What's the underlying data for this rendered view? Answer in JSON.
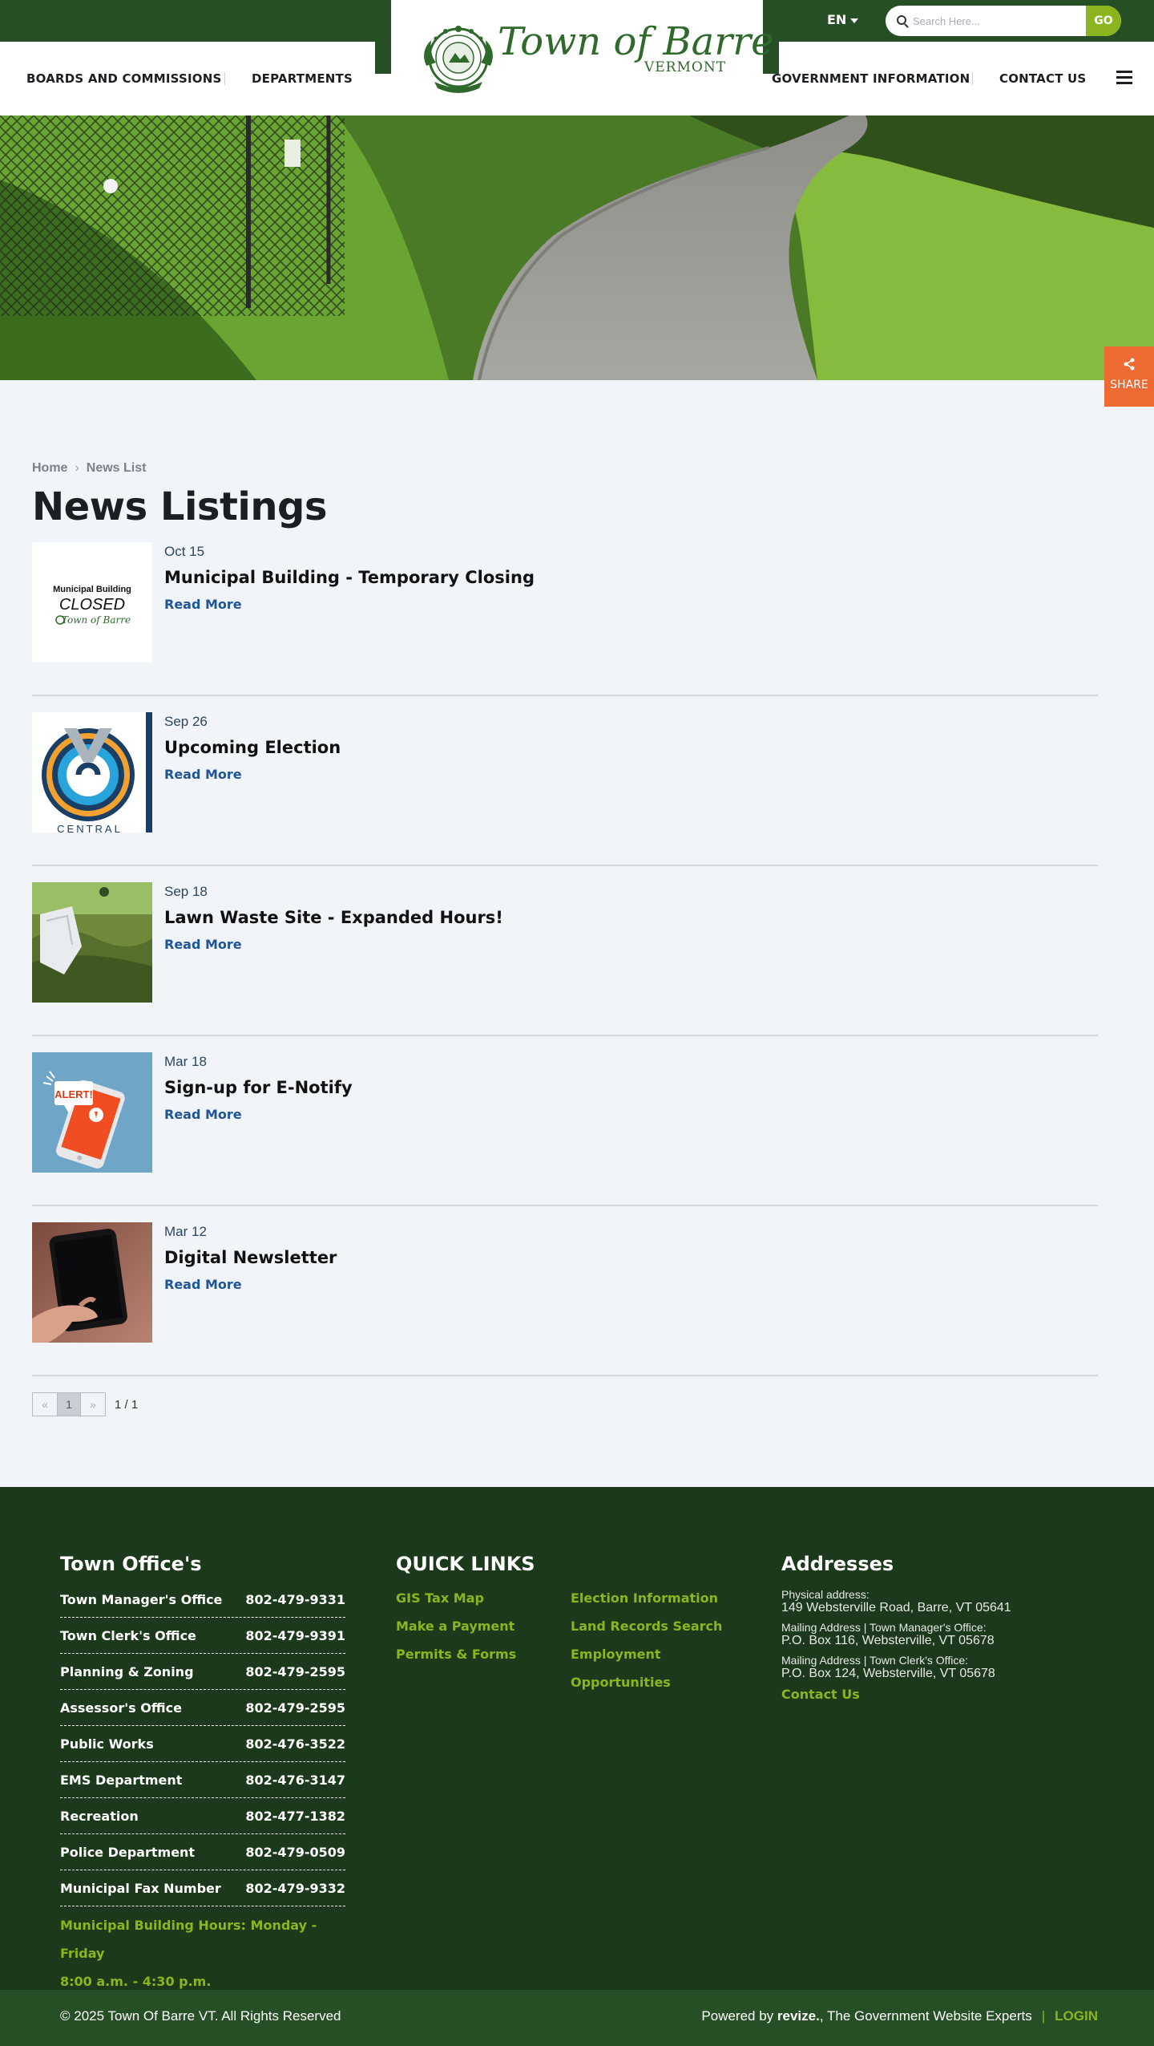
{
  "topbar": {
    "lang": "EN",
    "search_placeholder": "Search Here...",
    "go_label": "GO"
  },
  "nav": {
    "left": [
      "BOARDS AND COMMISSIONS",
      "DEPARTMENTS"
    ],
    "right": [
      "GOVERNMENT INFORMATION",
      "CONTACT US"
    ],
    "logo_main": "Town of Barre",
    "logo_sub": "VERMONT"
  },
  "share_label": "SHARE",
  "breadcrumb": {
    "home": "Home",
    "current": "News List"
  },
  "page_title": "News Listings",
  "read_more": "Read More",
  "news": [
    {
      "date": "Oct 15",
      "title": "Municipal Building - Temporary Closing"
    },
    {
      "date": "Sep 26",
      "title": "Upcoming Election"
    },
    {
      "date": "Sep 18",
      "title": "Lawn Waste Site - Expanded Hours!"
    },
    {
      "date": "Mar 18",
      "title": "Sign-up for E-Notify"
    },
    {
      "date": "Mar 12",
      "title": "Digital Newsletter"
    }
  ],
  "thumbs": {
    "closed_line1": "Municipal Building",
    "closed_line2": "CLOSED",
    "closed_line3": "Town of Barre",
    "central_label": "CENTRAL",
    "alert_label": "ALERT!"
  },
  "pager": {
    "prev": "«",
    "current": "1",
    "next": "»",
    "count": "1 / 1"
  },
  "footer": {
    "offices_title": "Town Office's",
    "offices": [
      {
        "name": "Town Manager's Office",
        "phone": "802-479-9331"
      },
      {
        "name": "Town Clerk's Office",
        "phone": "802-479-9391"
      },
      {
        "name": "Planning & Zoning",
        "phone": "802-479-2595"
      },
      {
        "name": "Assessor's Office",
        "phone": "802-479-2595"
      },
      {
        "name": "Public Works",
        "phone": "802-476-3522"
      },
      {
        "name": "EMS Department",
        "phone": "802-476-3147"
      },
      {
        "name": "Recreation",
        "phone": "802-477-1382"
      },
      {
        "name": "Police Department",
        "phone": "802-479-0509"
      },
      {
        "name": "Municipal Fax Number",
        "phone": "802-479-9332"
      }
    ],
    "hours_line1": "Municipal Building Hours:  Monday - Friday",
    "hours_line2": "8:00 a.m. - 4:30 p.m.",
    "quick_title": "QUICK LINKS",
    "quick_col1": [
      "GIS Tax Map",
      "Make a Payment",
      "Permits & Forms"
    ],
    "quick_col2": [
      "Election Information",
      "Land Records Search",
      "Employment",
      "Opportunities"
    ],
    "addr_title": "Addresses",
    "addresses": [
      {
        "label": "Physical address:",
        "value": "149 Websterville Road, Barre, VT 05641"
      },
      {
        "label": "Mailing Address | Town Manager's Office:",
        "value": "P.O. Box 116, Websterville, VT 05678"
      },
      {
        "label": "Mailing Address | Town Clerk's Office:",
        "value": "P.O. Box 124, Websterville, VT 05678"
      }
    ],
    "contact_link": "Contact Us",
    "copyright": "© 2025 Town Of Barre VT. All Rights Reserved",
    "powered_pre": "Powered by ",
    "powered_brand": "revize.",
    "powered_post": ", The Government Website Experts",
    "login": "LOGIN"
  }
}
